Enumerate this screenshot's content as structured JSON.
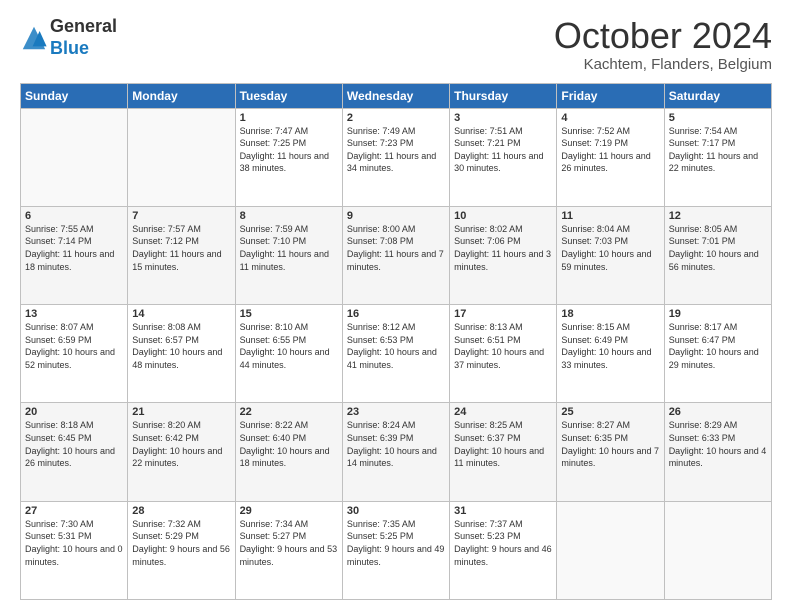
{
  "header": {
    "logo_general": "General",
    "logo_blue": "Blue",
    "month_title": "October 2024",
    "location": "Kachtem, Flanders, Belgium"
  },
  "weekdays": [
    "Sunday",
    "Monday",
    "Tuesday",
    "Wednesday",
    "Thursday",
    "Friday",
    "Saturday"
  ],
  "weeks": [
    [
      {
        "day": "",
        "info": ""
      },
      {
        "day": "",
        "info": ""
      },
      {
        "day": "1",
        "info": "Sunrise: 7:47 AM\nSunset: 7:25 PM\nDaylight: 11 hours and 38 minutes."
      },
      {
        "day": "2",
        "info": "Sunrise: 7:49 AM\nSunset: 7:23 PM\nDaylight: 11 hours and 34 minutes."
      },
      {
        "day": "3",
        "info": "Sunrise: 7:51 AM\nSunset: 7:21 PM\nDaylight: 11 hours and 30 minutes."
      },
      {
        "day": "4",
        "info": "Sunrise: 7:52 AM\nSunset: 7:19 PM\nDaylight: 11 hours and 26 minutes."
      },
      {
        "day": "5",
        "info": "Sunrise: 7:54 AM\nSunset: 7:17 PM\nDaylight: 11 hours and 22 minutes."
      }
    ],
    [
      {
        "day": "6",
        "info": "Sunrise: 7:55 AM\nSunset: 7:14 PM\nDaylight: 11 hours and 18 minutes."
      },
      {
        "day": "7",
        "info": "Sunrise: 7:57 AM\nSunset: 7:12 PM\nDaylight: 11 hours and 15 minutes."
      },
      {
        "day": "8",
        "info": "Sunrise: 7:59 AM\nSunset: 7:10 PM\nDaylight: 11 hours and 11 minutes."
      },
      {
        "day": "9",
        "info": "Sunrise: 8:00 AM\nSunset: 7:08 PM\nDaylight: 11 hours and 7 minutes."
      },
      {
        "day": "10",
        "info": "Sunrise: 8:02 AM\nSunset: 7:06 PM\nDaylight: 11 hours and 3 minutes."
      },
      {
        "day": "11",
        "info": "Sunrise: 8:04 AM\nSunset: 7:03 PM\nDaylight: 10 hours and 59 minutes."
      },
      {
        "day": "12",
        "info": "Sunrise: 8:05 AM\nSunset: 7:01 PM\nDaylight: 10 hours and 56 minutes."
      }
    ],
    [
      {
        "day": "13",
        "info": "Sunrise: 8:07 AM\nSunset: 6:59 PM\nDaylight: 10 hours and 52 minutes."
      },
      {
        "day": "14",
        "info": "Sunrise: 8:08 AM\nSunset: 6:57 PM\nDaylight: 10 hours and 48 minutes."
      },
      {
        "day": "15",
        "info": "Sunrise: 8:10 AM\nSunset: 6:55 PM\nDaylight: 10 hours and 44 minutes."
      },
      {
        "day": "16",
        "info": "Sunrise: 8:12 AM\nSunset: 6:53 PM\nDaylight: 10 hours and 41 minutes."
      },
      {
        "day": "17",
        "info": "Sunrise: 8:13 AM\nSunset: 6:51 PM\nDaylight: 10 hours and 37 minutes."
      },
      {
        "day": "18",
        "info": "Sunrise: 8:15 AM\nSunset: 6:49 PM\nDaylight: 10 hours and 33 minutes."
      },
      {
        "day": "19",
        "info": "Sunrise: 8:17 AM\nSunset: 6:47 PM\nDaylight: 10 hours and 29 minutes."
      }
    ],
    [
      {
        "day": "20",
        "info": "Sunrise: 8:18 AM\nSunset: 6:45 PM\nDaylight: 10 hours and 26 minutes."
      },
      {
        "day": "21",
        "info": "Sunrise: 8:20 AM\nSunset: 6:42 PM\nDaylight: 10 hours and 22 minutes."
      },
      {
        "day": "22",
        "info": "Sunrise: 8:22 AM\nSunset: 6:40 PM\nDaylight: 10 hours and 18 minutes."
      },
      {
        "day": "23",
        "info": "Sunrise: 8:24 AM\nSunset: 6:39 PM\nDaylight: 10 hours and 14 minutes."
      },
      {
        "day": "24",
        "info": "Sunrise: 8:25 AM\nSunset: 6:37 PM\nDaylight: 10 hours and 11 minutes."
      },
      {
        "day": "25",
        "info": "Sunrise: 8:27 AM\nSunset: 6:35 PM\nDaylight: 10 hours and 7 minutes."
      },
      {
        "day": "26",
        "info": "Sunrise: 8:29 AM\nSunset: 6:33 PM\nDaylight: 10 hours and 4 minutes."
      }
    ],
    [
      {
        "day": "27",
        "info": "Sunrise: 7:30 AM\nSunset: 5:31 PM\nDaylight: 10 hours and 0 minutes."
      },
      {
        "day": "28",
        "info": "Sunrise: 7:32 AM\nSunset: 5:29 PM\nDaylight: 9 hours and 56 minutes."
      },
      {
        "day": "29",
        "info": "Sunrise: 7:34 AM\nSunset: 5:27 PM\nDaylight: 9 hours and 53 minutes."
      },
      {
        "day": "30",
        "info": "Sunrise: 7:35 AM\nSunset: 5:25 PM\nDaylight: 9 hours and 49 minutes."
      },
      {
        "day": "31",
        "info": "Sunrise: 7:37 AM\nSunset: 5:23 PM\nDaylight: 9 hours and 46 minutes."
      },
      {
        "day": "",
        "info": ""
      },
      {
        "day": "",
        "info": ""
      }
    ]
  ]
}
